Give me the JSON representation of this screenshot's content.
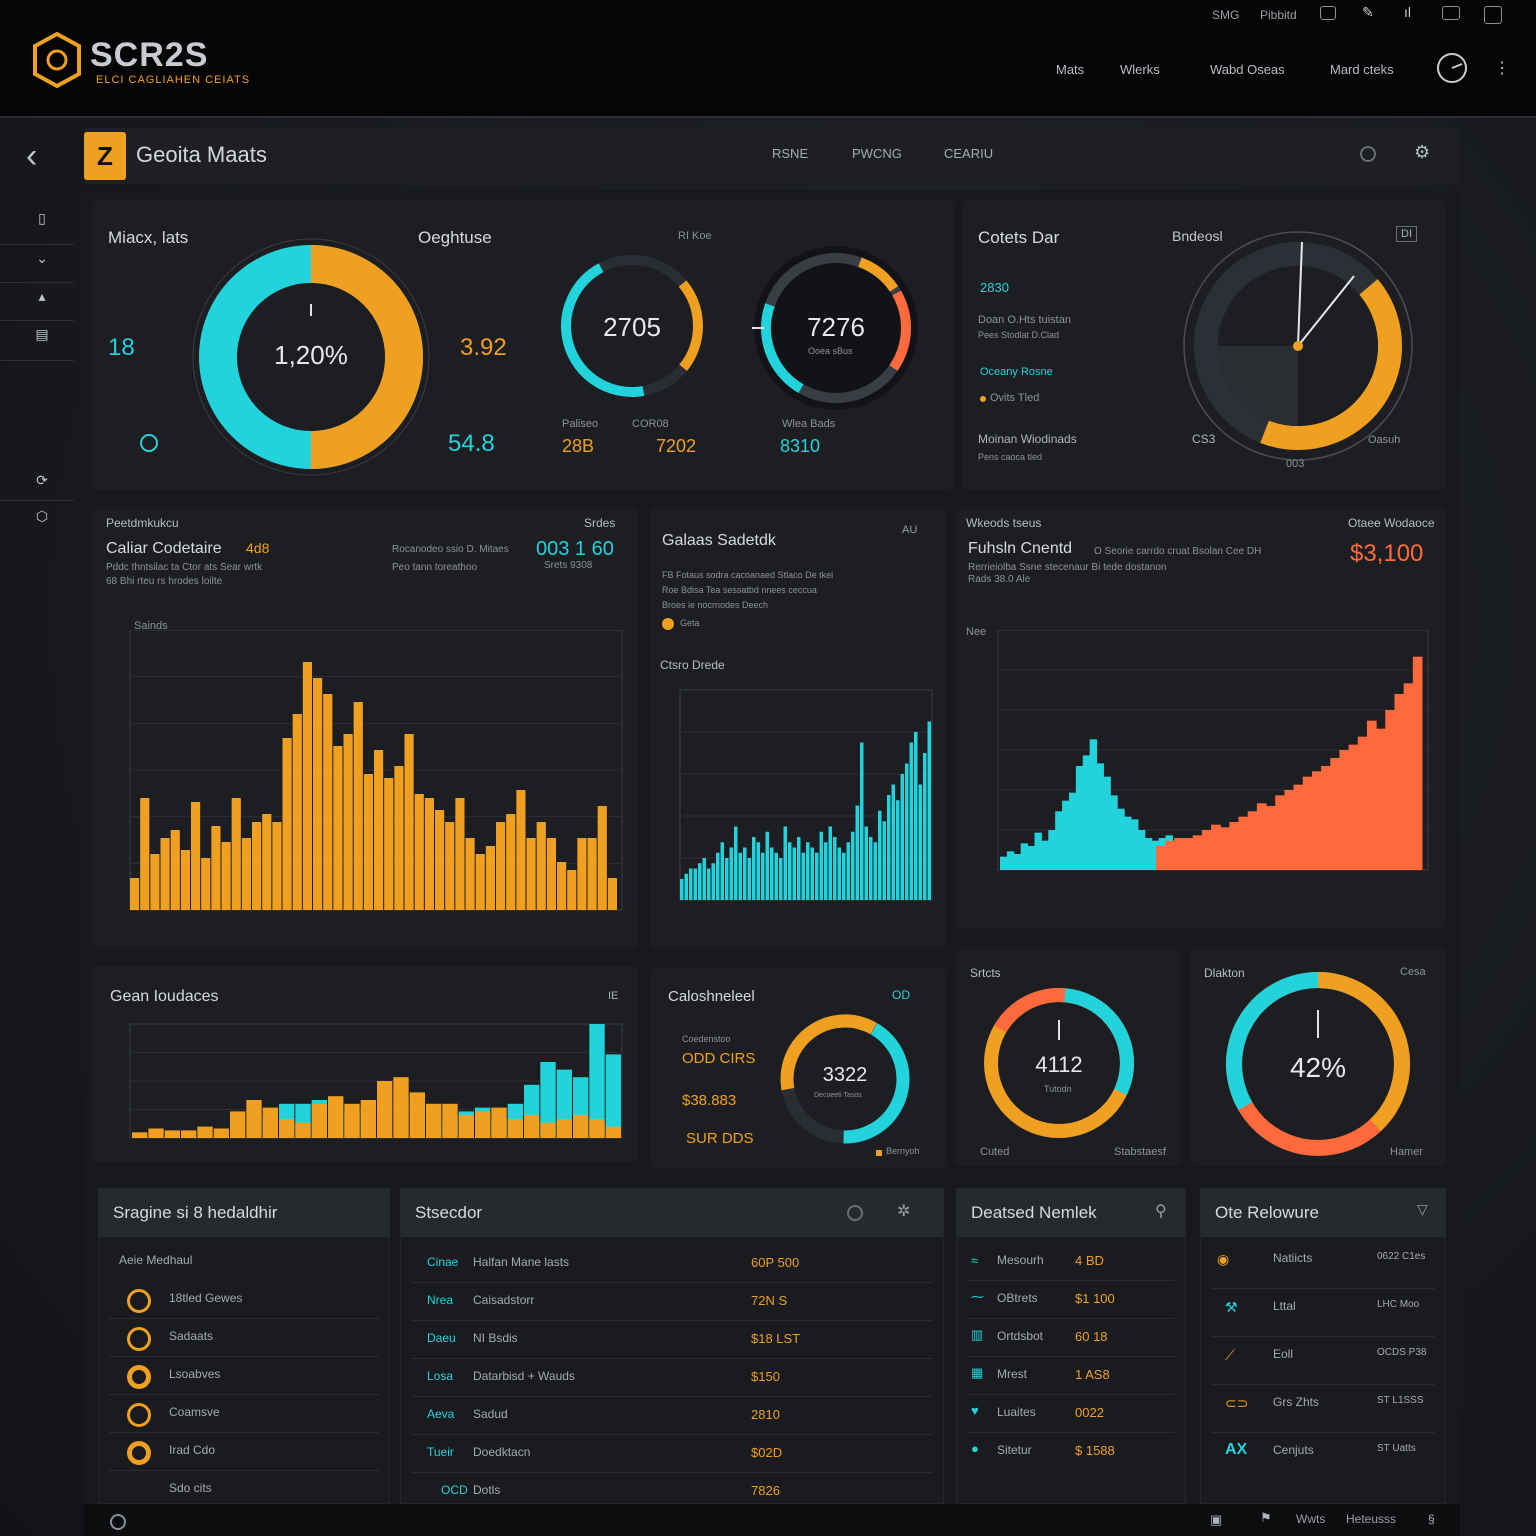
{
  "brand": {
    "name": "SCR2S",
    "tagline": "ELCI CAGLIAHEN CEIATS"
  },
  "topbar": {
    "small_items": [
      "SMG",
      "Pibbitd"
    ],
    "nav": [
      "Mats",
      "Wlerks",
      "Wabd Oseas",
      "Mard cteks"
    ]
  },
  "page": {
    "badge": "Z",
    "title": "Geoita Maats",
    "tabs": [
      "RSNE",
      "PWCNG",
      "CEARIU"
    ]
  },
  "colors": {
    "orange": "#f0a020",
    "cyan": "#22d3dc",
    "red": "#ff6a3d",
    "bg": "#15171b",
    "panel": "#1c1e22"
  },
  "top_left_panel": {
    "title": "Miacx, lats",
    "subtitle": "Oeghtuse",
    "badge_text": "RI Koe",
    "left_value": "18",
    "bottom_left": "54.8",
    "center_ring": "1,20%",
    "right_value": "3.92",
    "ring_a": {
      "value": "2705",
      "label_a": "Paliseo",
      "label_b": "COR08",
      "val_a": "28B",
      "val_b": "7202"
    },
    "ring_b": {
      "value": "7276",
      "sub": "Ooea sBus",
      "label": "Wlea Bads",
      "val": "8310"
    },
    "rings": {
      "main_fraction": 0.5,
      "ring_a_fraction": 0.72,
      "ring_b_fraction": 0.62
    }
  },
  "top_right_panel": {
    "title": "Cotets Dar",
    "subtitle": "Bndeosl",
    "badge": "DI",
    "value_1": "2830",
    "text_1": "Doan O.Hts tuistan",
    "text_2": "Pees Stodlat D.Clad",
    "highlight": "Oceany Rosne",
    "text_3": "Ovits Tled",
    "text_4": "Moinan Wiodinads",
    "text_5": "Pens caoca tled",
    "gauge_left": "CS3",
    "gauge_bottom": "003",
    "gauge_right": "Oasuh",
    "gauge_fraction": 0.42
  },
  "chart_left": {
    "header": "Peetdmkukcu",
    "title": "Caliar Codetaire",
    "title_val": "4d8",
    "right_head": "Srdes",
    "caption": "Rocanodeo ssio D. Mitaes",
    "big_val": "003 1 60",
    "sub1": "Pddc thntsilac ta Ctor ats Sear wrtk",
    "sub2": "68 Bhi rteu rs hrodes loilte",
    "sub3": "Peo tann toreathoo",
    "sub4": "Srets 9308",
    "axis_label": "Sainds"
  },
  "chart_mid": {
    "title": "Galaas Sadetdk",
    "badge": "AU",
    "lines": [
      "FB Fotaus sodra cacoanaed Stlaco De tkel",
      "Roe Bdisa Tea sessatbd nnees ceccua",
      "Broes ie nocrnodes Deech"
    ],
    "legend": "Geta",
    "sub_title": "Ctsro Drede"
  },
  "chart_right": {
    "header": "Wkeods tseus",
    "right_head": "Otaee Wodaoce",
    "title": "Fuhsln Cnentd",
    "caption": "O Seorie carrdo cruat Bsolan Cee DH",
    "big_val": "$3,100",
    "sub1": "Rerrieiolba Ssne stecenaur Bi tede dostanon",
    "sub2": "Rads 38.0 Ale",
    "axis_top": "Nee"
  },
  "chart_bottom_left": {
    "title": "Gean Ioudaces",
    "badge": "IE"
  },
  "donut_mid": {
    "title": "Caloshneleel",
    "badge": "OD",
    "label": "Coedenstoo",
    "vals": [
      "ODD CIRS",
      "$38.883",
      "SUR DDS"
    ],
    "center": "3322",
    "center_sub": "Decoeeti Tasos",
    "legend": "Bernyoh",
    "fraction": 0.78
  },
  "donut_a": {
    "title": "Srtcts",
    "center": "4112",
    "sub": "Tutodn",
    "bl": "Cuted",
    "br": "Stabstaesf"
  },
  "donut_b": {
    "title": "Dlakton",
    "right": "Cesa",
    "center": "42%",
    "br": "Hamer"
  },
  "list_1": {
    "title": "Sragine si 8 hedaldhir",
    "head_label": "Aeie Medhaul",
    "items": [
      "18tled Gewes",
      "Sadaats",
      "Lsoabves",
      "Coamsve",
      "Irad Cdo",
      "Sdo cits"
    ]
  },
  "list_2": {
    "title": "Stsecdor",
    "rows": [
      {
        "a": "Cinae",
        "b": "Halfan Mane lasts",
        "v": "60P 500"
      },
      {
        "a": "Nrea",
        "b": "Caisadstorr",
        "v": "72N S"
      },
      {
        "a": "Daeu",
        "b": "NI Bsdis",
        "v": "$18 LST"
      },
      {
        "a": "Losa",
        "b": "Datarbisd + Wauds",
        "v": "$150"
      },
      {
        "a": "Aeva",
        "b": "Sadud",
        "v": "2810"
      },
      {
        "a": "Tueir",
        "b": "Doedktacn",
        "v": "$02D"
      },
      {
        "a": "OCD",
        "b": "Dotls",
        "v": "7826"
      }
    ]
  },
  "list_3": {
    "title": "Deatsed Nemlek",
    "rows": [
      {
        "b": "Mesourh",
        "v": "4 BD"
      },
      {
        "b": "OBtrets",
        "v": "$1 100"
      },
      {
        "b": "Ortdsbot",
        "v": "60 18"
      },
      {
        "b": "Mrest",
        "v": "1 AS8"
      },
      {
        "b": "Luaites",
        "v": "0022"
      },
      {
        "b": "Sitetur",
        "v": "$ 1588"
      }
    ]
  },
  "list_4": {
    "title": "Ote Relowure",
    "rows": [
      {
        "b": "Natiicts",
        "v": "0622 C1es"
      },
      {
        "b": "Lttal",
        "v": "LHC Moo"
      },
      {
        "b": "Eoll",
        "v": "OCDS P38"
      },
      {
        "b": "Grs Zhts",
        "v": "ST L1SSS"
      },
      {
        "b": "Cenjuts",
        "v": "ST Uatts"
      }
    ]
  },
  "footer": {
    "right": [
      "Wwts",
      "Heteusss"
    ]
  },
  "chart_data": [
    {
      "type": "bar",
      "id": "left-orange",
      "values": [
        8,
        28,
        14,
        18,
        20,
        15,
        27,
        13,
        21,
        17,
        28,
        18,
        22,
        24,
        22,
        43,
        49,
        62,
        58,
        54,
        41,
        44,
        52,
        34,
        40,
        33,
        36,
        44,
        29,
        28,
        25,
        22,
        28,
        18,
        14,
        16,
        22,
        24,
        30,
        18,
        22,
        18,
        12,
        10,
        18,
        18,
        26,
        8
      ],
      "ylim": [
        0,
        70
      ]
    },
    {
      "type": "bar",
      "id": "mid-cyan",
      "values": [
        4,
        5,
        6,
        6,
        7,
        8,
        6,
        7,
        9,
        11,
        8,
        10,
        14,
        9,
        10,
        8,
        12,
        11,
        9,
        13,
        10,
        9,
        8,
        14,
        11,
        10,
        12,
        9,
        11,
        10,
        9,
        13,
        11,
        14,
        12,
        10,
        9,
        11,
        13,
        18,
        30,
        14,
        12,
        11,
        17,
        15,
        20,
        22,
        19,
        24,
        26,
        30,
        32,
        22,
        28,
        34
      ],
      "ylim": [
        0,
        40
      ]
    },
    {
      "type": "area",
      "id": "right-cyan-red",
      "series": [
        {
          "name": "cyan",
          "values": [
            10,
            14,
            12,
            20,
            18,
            28,
            22,
            30,
            44,
            52,
            58,
            78,
            86,
            98,
            80,
            70,
            56,
            46,
            40,
            38,
            30,
            24,
            22,
            24,
            26,
            22,
            24,
            22,
            24
          ]
        },
        {
          "name": "red",
          "values": [
            18,
            22,
            24,
            24,
            26,
            30,
            34,
            32,
            36,
            40,
            44,
            50,
            48,
            56,
            60,
            64,
            70,
            74,
            78,
            84,
            90,
            94,
            100,
            112,
            106,
            120,
            132,
            140,
            160
          ]
        }
      ],
      "ylim": [
        0,
        180
      ]
    },
    {
      "type": "bar",
      "id": "bottom-left-mixed",
      "series": [
        {
          "name": "orange",
          "values": [
            3,
            5,
            4,
            4,
            6,
            5,
            14,
            20,
            16,
            10,
            8,
            18,
            22,
            18,
            20,
            30,
            32,
            24,
            18,
            18,
            12,
            14,
            16,
            10,
            12,
            8,
            10,
            12,
            10,
            6
          ]
        },
        {
          "name": "cyan",
          "values": [
            0,
            0,
            0,
            0,
            0,
            0,
            0,
            0,
            12,
            18,
            18,
            20,
            20,
            14,
            16,
            0,
            0,
            0,
            6,
            12,
            14,
            16,
            10,
            18,
            28,
            40,
            36,
            32,
            60,
            44
          ]
        }
      ],
      "ylim": [
        0,
        60
      ]
    }
  ]
}
